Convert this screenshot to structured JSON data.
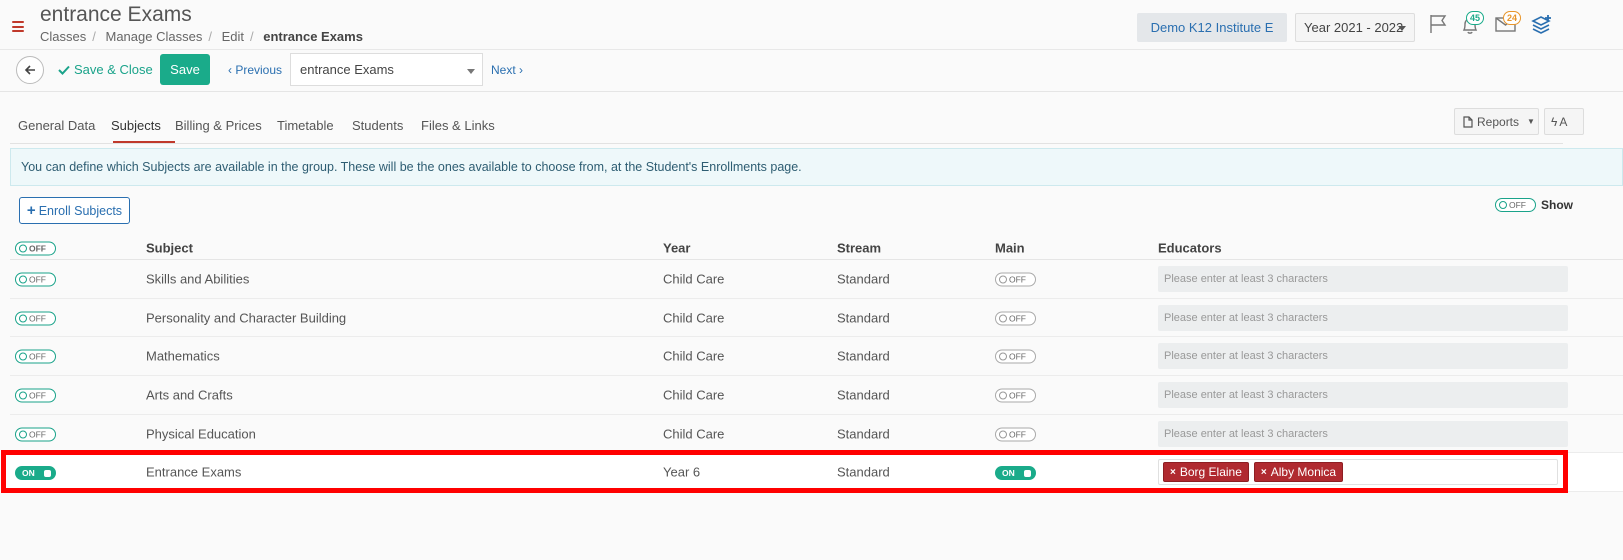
{
  "header": {
    "title": "entrance Exams",
    "breadcrumb": [
      "Classes",
      "Manage Classes",
      "Edit",
      "entrance Exams"
    ],
    "institute": "Demo K12 Institute E",
    "year": "Year 2021 - 2022",
    "notifications_count": "45",
    "messages_count": "24"
  },
  "toolbar": {
    "save_close_label": "Save & Close",
    "save_label": "Save",
    "previous_label": "Previous",
    "class_select_value": "entrance Exams",
    "next_label": "Next"
  },
  "tabs": [
    {
      "label": "General Data"
    },
    {
      "label": "Subjects"
    },
    {
      "label": "Billing & Prices"
    },
    {
      "label": "Timetable"
    },
    {
      "label": "Students"
    },
    {
      "label": "Files & Links"
    }
  ],
  "reports_label": "Reports",
  "actions_label": "A",
  "info_text": "You can define which Subjects are available in the group. These will be the ones available to choose from, at the Student's Enrollments page.",
  "enroll_label": "Enroll Subjects",
  "show_label": "Show",
  "toggle_off_label": "OFF",
  "toggle_on_label": "ON",
  "table": {
    "headers": {
      "subject": "Subject",
      "year": "Year",
      "stream": "Stream",
      "main": "Main",
      "educators": "Educators"
    },
    "placeholder": "Please enter at least 3 characters",
    "rows": [
      {
        "subject": "Skills and Abilities",
        "year": "Child Care",
        "stream": "Standard"
      },
      {
        "subject": "Personality and Character Building",
        "year": "Child Care",
        "stream": "Standard"
      },
      {
        "subject": "Mathematics",
        "year": "Child Care",
        "stream": "Standard"
      },
      {
        "subject": "Arts and Crafts",
        "year": "Child Care",
        "stream": "Standard"
      },
      {
        "subject": "Physical Education",
        "year": "Child Care",
        "stream": "Standard"
      },
      {
        "subject": "Entrance Exams",
        "year": "Year 6",
        "stream": "Standard",
        "educators": [
          "Borg Elaine",
          "Alby Monica"
        ]
      }
    ]
  },
  "colors": {
    "accent": "#1aab8a",
    "brand_red": "#c0392b",
    "link": "#2a6fb0",
    "tag": "#b02a30"
  }
}
